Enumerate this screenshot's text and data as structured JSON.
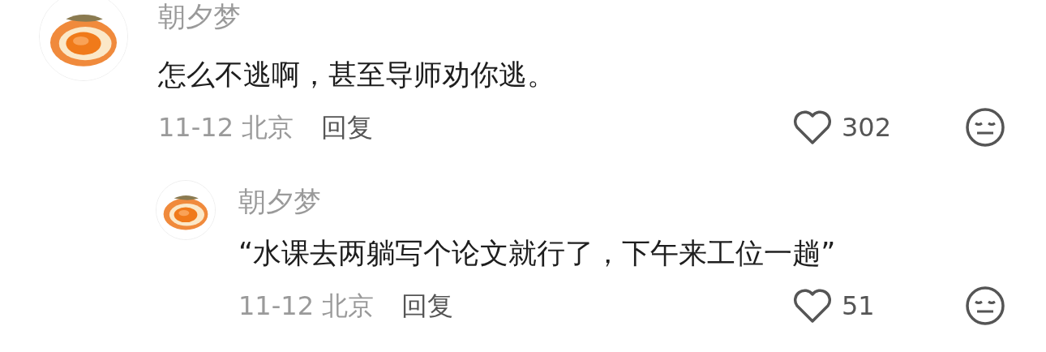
{
  "comments": [
    {
      "user": "朝夕梦",
      "text": "怎么不逃啊，甚至导师劝你逃。",
      "date": "11-12",
      "location": "北京",
      "reply": "回复",
      "likes": "302",
      "replies": [
        {
          "user": "朝夕梦",
          "text": "“水课去两躺写个论文就行了，下午来工位一趟”",
          "date": "11-12",
          "location": "北京",
          "reply": "回复",
          "likes": "51"
        }
      ]
    }
  ]
}
